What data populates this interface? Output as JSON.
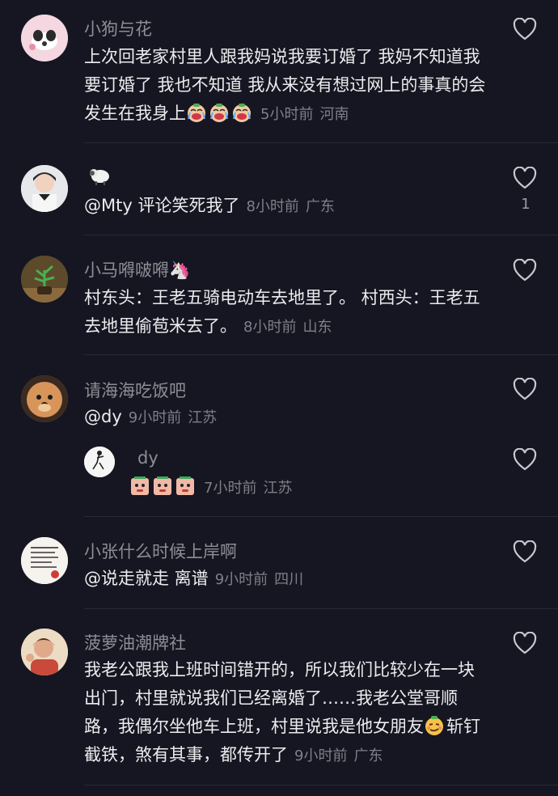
{
  "comments": [
    {
      "name": "小狗与花",
      "text": "上次回老家村里人跟我妈说我要订婚了 我妈不知道我要订婚了 我也不知道 我从来没有想过网上的事真的会发生在我身上",
      "emoji_icons": [
        "crying-face-icon",
        "crying-face-icon",
        "crying-face-icon"
      ],
      "time": "5小时前",
      "location": "河南",
      "avatar": "puppy-flower-avatar"
    },
    {
      "name": "🐑",
      "text": "@Mty 评论笑死我了",
      "time": "8小时前",
      "location": "广东",
      "likes": "1",
      "avatar": "child-avatar"
    },
    {
      "name": "小马嘚啵嘚🦄",
      "text": "村东头：王老五骑电动车去地里了。 村西头：王老五去地里偷苞米去了。",
      "time": "8小时前",
      "location": "山东",
      "avatar": "plant-avatar"
    },
    {
      "name": "请海海吃饭吧",
      "text": "@dy",
      "time": "9小时前",
      "location": "江苏",
      "avatar": "dog-avatar",
      "reply": {
        "name": "dy",
        "emoji_icons": [
          "sweat-face-icon",
          "sweat-face-icon",
          "sweat-face-icon"
        ],
        "time": "7小时前",
        "location": "江苏",
        "avatar": "sketch-avatar"
      }
    },
    {
      "name": "小张什么时候上岸啊",
      "text": "@说走就走 离谱",
      "time": "9小时前",
      "location": "四川",
      "avatar": "note-avatar"
    },
    {
      "name": "菠萝油潮牌社",
      "text": "我老公跟我上班时间错开的，所以我们比较少在一块出门，村里就说我们已经离婚了……我老公堂哥顺路，我偶尔坐他车上班，村里说我是他女朋友",
      "text_after_emoji": "斩钉截铁，煞有其事，都传开了",
      "emoji_icons": [
        "smirk-face-icon"
      ],
      "time": "9小时前",
      "location": "广东",
      "avatar": "woman-avatar"
    }
  ],
  "colors": {
    "background": "#161622",
    "name": "#8d8d95",
    "text": "#ececef",
    "meta": "#7f7f88"
  }
}
